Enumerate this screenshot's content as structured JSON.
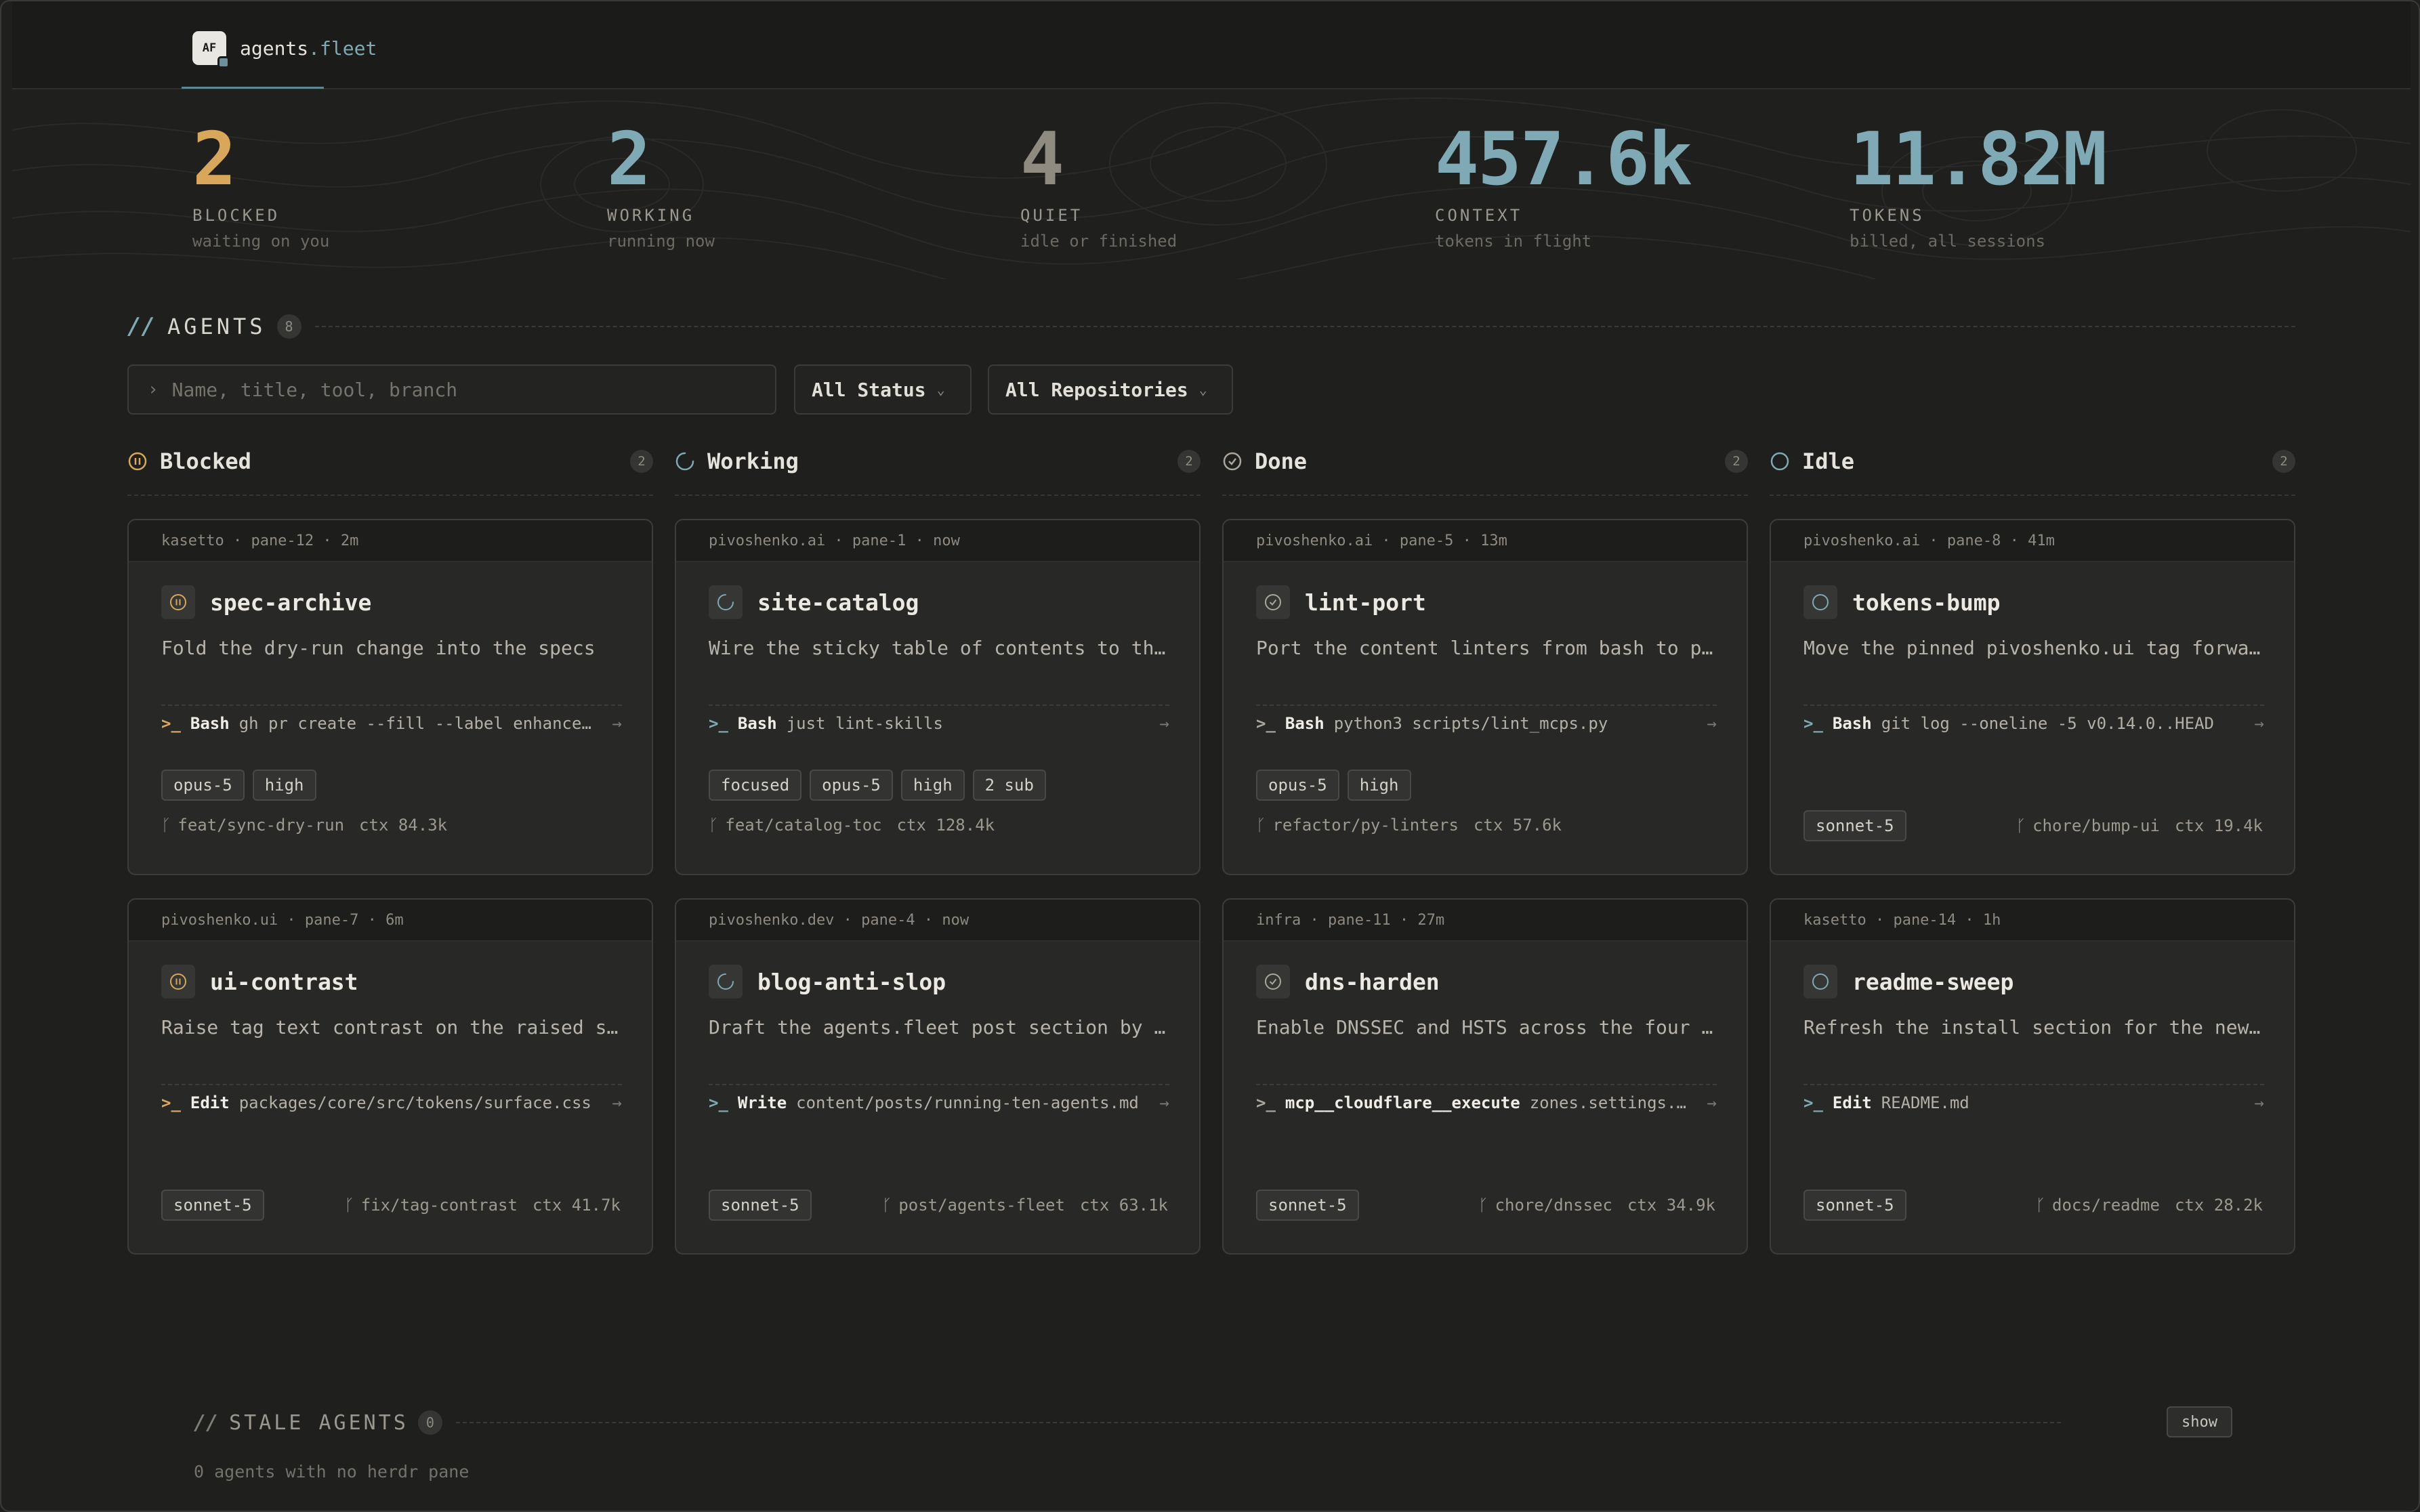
{
  "app": {
    "logo_text": "AF",
    "name_main": "agents",
    "name_suffix": ".fleet"
  },
  "stats": [
    {
      "value": "2",
      "label": "BLOCKED",
      "sub": "waiting on you",
      "color": "#d8a75c"
    },
    {
      "value": "2",
      "label": "WORKING",
      "sub": "running now",
      "color": "#7fa9b4"
    },
    {
      "value": "4",
      "label": "QUIET",
      "sub": "idle or finished",
      "color": "#8f8b81"
    },
    {
      "value": "457.6k",
      "label": "CONTEXT",
      "sub": "tokens in flight",
      "color": "#7fa9b4"
    },
    {
      "value": "11.82M",
      "label": "TOKENS",
      "sub": "billed, all sessions",
      "color": "#7fa9b4"
    }
  ],
  "agents_section": {
    "slashes": "//",
    "title": "AGENTS",
    "count": "8"
  },
  "filters": {
    "search_placeholder": "Name, title, tool, branch",
    "status": "All Status",
    "repos": "All Repositories"
  },
  "columns": [
    {
      "name": "Blocked",
      "count": "2",
      "color": "#d8a75c"
    },
    {
      "name": "Working",
      "count": "2",
      "color": "#7fa9b4"
    },
    {
      "name": "Done",
      "count": "2",
      "color": "#aaa69d"
    },
    {
      "name": "Idle",
      "count": "2",
      "color": "#7fa9b4"
    }
  ],
  "cards": [
    {
      "meta": "kasetto · pane-12 · 2m",
      "title": "spec-archive",
      "desc": "Fold the dry-run change into the specs",
      "tool": "Bash",
      "cmd": "gh pr create --fill --label enhancement",
      "tags": [
        "opus-5",
        "high"
      ],
      "branch": "feat/sync-dry-run",
      "ctx": "ctx 84.3k"
    },
    {
      "meta": "pivoshenko.ai · pane-1 · now",
      "title": "site-catalog",
      "desc": "Wire the sticky table of contents to the catalog",
      "tool": "Bash",
      "cmd": "just lint-skills",
      "tags": [
        "focused",
        "opus-5",
        "high",
        "2 sub"
      ],
      "branch": "feat/catalog-toc",
      "ctx": "ctx 128.4k"
    },
    {
      "meta": "pivoshenko.ai · pane-5 · 13m",
      "title": "lint-port",
      "desc": "Port the content linters from bash to python",
      "tool": "Bash",
      "cmd": "python3 scripts/lint_mcps.py",
      "tags": [
        "opus-5",
        "high"
      ],
      "branch": "refactor/py-linters",
      "ctx": "ctx 57.6k"
    },
    {
      "meta": "pivoshenko.ai · pane-8 · 41m",
      "title": "tokens-bump",
      "desc": "Move the pinned pivoshenko.ui tag forward",
      "tool": "Bash",
      "cmd": "git log --oneline -5 v0.14.0..HEAD",
      "tags": [
        "sonnet-5"
      ],
      "branch": "chore/bump-ui",
      "ctx": "ctx 19.4k"
    },
    {
      "meta": "pivoshenko.ui · pane-7 · 6m",
      "title": "ui-contrast",
      "desc": "Raise tag text contrast on the raised surface",
      "tool": "Edit",
      "cmd": "packages/core/src/tokens/surface.css",
      "tags": [
        "sonnet-5"
      ],
      "branch": "fix/tag-contrast",
      "ctx": "ctx 41.7k"
    },
    {
      "meta": "pivoshenko.dev · pane-4 · now",
      "title": "blog-anti-slop",
      "desc": "Draft the agents.fleet post section by section",
      "tool": "Write",
      "cmd": "content/posts/running-ten-agents.md",
      "tags": [
        "sonnet-5"
      ],
      "branch": "post/agents-fleet",
      "ctx": "ctx 63.1k"
    },
    {
      "meta": "infra · pane-11 · 27m",
      "title": "dns-harden",
      "desc": "Enable DNSSEC and HSTS across the four zones",
      "tool": "mcp__cloudflare__execute",
      "cmd": "zones.settings.edit",
      "tags": [
        "sonnet-5"
      ],
      "branch": "chore/dnssec",
      "ctx": "ctx 34.9k"
    },
    {
      "meta": "kasetto · pane-14 · 1h",
      "title": "readme-sweep",
      "desc": "Refresh the install section for the new release",
      "tool": "Edit",
      "cmd": "README.md",
      "tags": [
        "sonnet-5"
      ],
      "branch": "docs/readme",
      "ctx": "ctx 28.2k"
    }
  ],
  "stale": {
    "slashes": "//",
    "title": "STALE AGENTS",
    "count": "0",
    "button": "show",
    "sub": "0 agents with no herdr pane"
  },
  "icons": {
    "prompt": "terminal-prompt-icon",
    "arrow": "arrow-right-icon",
    "branch": "git-branch-icon",
    "search": "chevron-right-icon",
    "caret": "chevron-down-icon"
  }
}
